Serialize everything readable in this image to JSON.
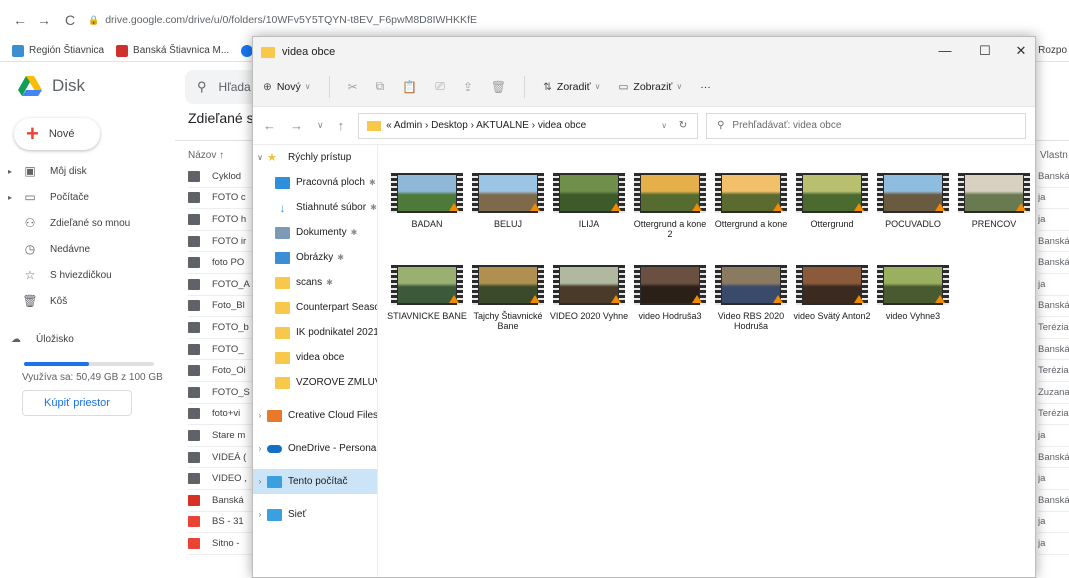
{
  "browser": {
    "url": "drive.google.com/drive/u/0/folders/10WFv5Y5TQYN-t8EV_F6pwM8D8IWHKKfE",
    "bookmarks": [
      {
        "label": "Región Štiavnica",
        "color": "#3a8fd0"
      },
      {
        "label": "Banská Štiavnica M...",
        "color": "#d0302b"
      },
      {
        "label": "R",
        "color": "#1877f2"
      }
    ],
    "bookmark_right": "Rozpo"
  },
  "drive": {
    "app_name": "Disk",
    "search_placeholder": "Hľada",
    "new_label": "Nové",
    "section_title": "Zdieľané sc",
    "nav": [
      {
        "label": "Môj disk",
        "icon": "drive-icon"
      },
      {
        "label": "Počítače",
        "icon": "computer-icon"
      },
      {
        "label": "Zdieľané so mnou",
        "icon": "people-icon"
      },
      {
        "label": "Nedávne",
        "icon": "clock-icon"
      },
      {
        "label": "S hviezdičkou",
        "icon": "star-icon"
      },
      {
        "label": "Kôš",
        "icon": "trash-icon"
      }
    ],
    "storage_label": "Úložisko",
    "storage_used_fraction": 0.5,
    "storage_text": "Využíva sa: 50,49 GB z 100 GB",
    "buy_label": "Kúpiť priestor",
    "col_name": "Názov",
    "col_owner": "Vlastn",
    "files": [
      {
        "name": "Cyklod",
        "type": "folder",
        "owner": "Banská"
      },
      {
        "name": "FOTO c",
        "type": "folder",
        "owner": "ja"
      },
      {
        "name": "FOTO h",
        "type": "folder",
        "owner": "ja"
      },
      {
        "name": "FOTO ir",
        "type": "folder",
        "owner": "Banská"
      },
      {
        "name": "foto PO",
        "type": "folder",
        "owner": "Banská"
      },
      {
        "name": "FOTO_A",
        "type": "folder",
        "owner": "ja"
      },
      {
        "name": "Foto_Bl",
        "type": "folder",
        "owner": "Banská"
      },
      {
        "name": "FOTO_b",
        "type": "folder",
        "owner": "Terézia"
      },
      {
        "name": "FOTO_",
        "type": "folder",
        "owner": "Banská"
      },
      {
        "name": "Foto_Oi",
        "type": "folder",
        "owner": "Terézia"
      },
      {
        "name": "FOTO_S",
        "type": "folder",
        "owner": "Zuzana"
      },
      {
        "name": "foto+vi",
        "type": "folder",
        "owner": "Terézia"
      },
      {
        "name": "Stare m",
        "type": "folder",
        "owner": "ja"
      },
      {
        "name": "VIDEÁ (",
        "type": "folder",
        "owner": "Banská"
      },
      {
        "name": "VIDEO ,",
        "type": "folder",
        "owner": "ja"
      },
      {
        "name": "Banská",
        "type": "file",
        "owner": "Banská"
      },
      {
        "name": "BS - 31",
        "type": "pdf",
        "owner": "ja"
      },
      {
        "name": "Sitno -",
        "type": "pdf",
        "owner": "ja"
      }
    ]
  },
  "explorer": {
    "title": "videa obce",
    "toolbar": {
      "new_label": "Nový",
      "sort_label": "Zoradiť",
      "view_label": "Zobraziť",
      "more_label": "···"
    },
    "path": "« Admin › Desktop › AKTUALNE › videa obce",
    "search_placeholder": "Prehľadávať: videa obce",
    "nav": [
      {
        "label": "Rýchly prístup",
        "icon": "star-icon",
        "color": "#f2c12e",
        "chev": "∨",
        "pin": false
      },
      {
        "label": "Pracovná ploch",
        "icon": "desktop-icon",
        "color": "#2f8fdb",
        "chev": "",
        "pin": true
      },
      {
        "label": "Stiahnuté súbor",
        "icon": "download-icon",
        "color": "#2f8fdb",
        "chev": "",
        "pin": true
      },
      {
        "label": "Dokumenty",
        "icon": "documents-icon",
        "color": "#7d9bb6",
        "chev": "",
        "pin": true
      },
      {
        "label": "Obrázky",
        "icon": "pictures-icon",
        "color": "#3b8ed6",
        "chev": "",
        "pin": true
      },
      {
        "label": "scans",
        "icon": "folder-icon",
        "color": "#f8c84a",
        "chev": "",
        "pin": true
      },
      {
        "label": "Counterpart Seaso",
        "icon": "folder-icon",
        "color": "#f8c84a",
        "chev": "",
        "pin": false
      },
      {
        "label": "IK podnikatel 2021",
        "icon": "folder-icon",
        "color": "#f8c84a",
        "chev": "",
        "pin": false
      },
      {
        "label": "videa obce",
        "icon": "folder-icon",
        "color": "#f8c84a",
        "chev": "",
        "pin": false
      },
      {
        "label": "VZOROVE ZMLUV",
        "icon": "folder-icon",
        "color": "#f8c84a",
        "chev": "",
        "pin": false
      },
      {
        "label": "Creative Cloud Files",
        "icon": "creative-cloud-icon",
        "color": "#e8792b",
        "chev": "›",
        "pin": false
      },
      {
        "label": "OneDrive - Personal",
        "icon": "onedrive-icon",
        "color": "#1570c4",
        "chev": "›",
        "pin": false
      },
      {
        "label": "Tento počítač",
        "icon": "computer-icon",
        "color": "#3aa0e0",
        "chev": "›",
        "pin": false,
        "selected": true
      },
      {
        "label": "Sieť",
        "icon": "network-icon",
        "color": "#3aa0e0",
        "chev": "›",
        "pin": false
      }
    ],
    "videos": [
      {
        "label": "BADAN",
        "colors": [
          "#8fb8d8",
          "#4d7a3a"
        ]
      },
      {
        "label": "BELUJ",
        "colors": [
          "#9cc4e4",
          "#7e6a4a"
        ]
      },
      {
        "label": "ILIJA",
        "colors": [
          "#6f8f4a",
          "#3c5a2a"
        ]
      },
      {
        "label": "Ottergrund a kone 2",
        "colors": [
          "#e5b04a",
          "#556b2f"
        ]
      },
      {
        "label": "Ottergrund a kone",
        "colors": [
          "#f2c06a",
          "#5b6b2f"
        ]
      },
      {
        "label": "Ottergrund",
        "colors": [
          "#b8c070",
          "#4a6a30"
        ]
      },
      {
        "label": "POCUVADLO",
        "colors": [
          "#8fbde0",
          "#6a5a40"
        ]
      },
      {
        "label": "PRENCOV",
        "colors": [
          "#d8d0c0",
          "#6a7a50"
        ]
      },
      {
        "label": "STIAVNICKE BANE",
        "colors": [
          "#9ab070",
          "#3c5a3a"
        ]
      },
      {
        "label": "Tajchy Štiavnické Bane",
        "colors": [
          "#b09050",
          "#3a4a2a"
        ]
      },
      {
        "label": "VIDEO 2020 Vyhne",
        "colors": [
          "#b0b8a0",
          "#4a3a2a"
        ]
      },
      {
        "label": "video Hodruša3",
        "colors": [
          "#6a5040",
          "#2a2018"
        ]
      },
      {
        "label": "Video RBS 2020 Hodruša",
        "colors": [
          "#8a7a60",
          "#3a4a6a"
        ]
      },
      {
        "label": "video Svätý Anton2",
        "colors": [
          "#8a5a3a",
          "#3a2a20"
        ]
      },
      {
        "label": "video Vyhne3",
        "colors": [
          "#9ab060",
          "#4a5a30"
        ]
      }
    ]
  }
}
